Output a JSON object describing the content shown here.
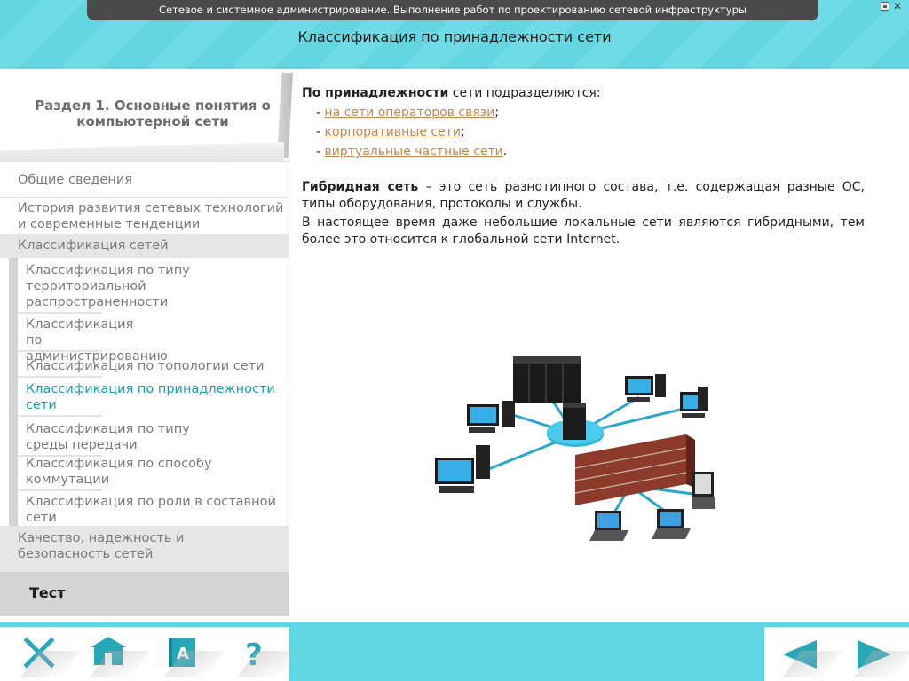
{
  "window": {
    "top_title": "Сетевое и системное администрирование. Выполнение работ по проектированию сетевой инфраструктуры",
    "page_title": "Классификация по принадлежности сети"
  },
  "sidebar": {
    "section_title": "Раздел 1. Основные понятия о компьютерной сети",
    "items": [
      {
        "label": "Общие сведения"
      },
      {
        "label": "История развития сетевых технологий и современные тенденции"
      },
      {
        "label": "Классификация сетей",
        "expanded": true
      },
      {
        "label": "Качество, надежность и безопасность сетей"
      },
      {
        "label": "Тест"
      }
    ],
    "subitems": [
      {
        "label": "Классификация по типу территориальной распространенности"
      },
      {
        "label": "Классификация по администрированию"
      },
      {
        "label": "Классификация по топологии сети"
      },
      {
        "label": "Классификация по принадлежности сети",
        "active": true
      },
      {
        "label": "Классификация по типу среды передачи"
      },
      {
        "label": "Классификация по способу коммутации"
      },
      {
        "label": "Классификация по роли в составной сети"
      }
    ]
  },
  "content": {
    "intro_bold": "По принадлежности",
    "intro_rest": " сети подразделяются:",
    "list": [
      {
        "prefix": "- ",
        "link": "на сети операторов связи",
        "suffix": ";"
      },
      {
        "prefix": "- ",
        "link": "корпоративные сети",
        "suffix": ";"
      },
      {
        "prefix": "- ",
        "link": "виртуальные частные сети",
        "suffix": "."
      }
    ],
    "hybrid_bold": "Гибридная сеть",
    "hybrid_rest": " – это сеть разнотипного состава, т.е. содержащая разные ОС, типы оборудования, протоколы и службы.",
    "hybrid_note": "В настоящее время даже небольшие локальные сети являются гибридными, тем более это относится к глобальной сети Internet."
  },
  "toolbar": {
    "close_icon": "close-icon",
    "home_icon": "home-icon",
    "glossary_icon": "glossary-book-icon",
    "glossary_letter": "A",
    "help_icon": "help-icon",
    "help_glyph": "?",
    "prev_icon": "arrow-left-icon",
    "next_icon": "arrow-right-icon"
  },
  "colors": {
    "accent": "#5fd6e2",
    "icon": "#27a7b8",
    "active_item": "#1aa0ad",
    "link": "#c8864b",
    "title_bar": "#4a4a4a"
  }
}
